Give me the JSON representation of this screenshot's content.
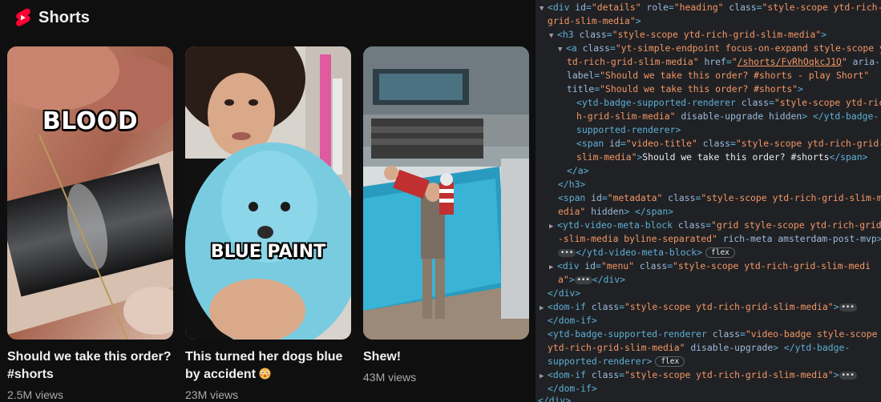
{
  "shelf": {
    "title": "Shorts",
    "cards": [
      {
        "title": "Should we take this order? #shorts",
        "title_line1": "Should we take this order?",
        "title_line2": "#shorts",
        "views": "2.5M views",
        "overlay": "BLOOD"
      },
      {
        "title": "This turned her dogs blue by accident",
        "title_line1": "This turned her dogs blue",
        "title_line2": "by accident",
        "views": "23M views",
        "overlay": "BLUE PAINT"
      },
      {
        "title": "Shew!",
        "title_line1": "Shew!",
        "title_line2": "",
        "views": "43M views",
        "overlay": ""
      }
    ]
  },
  "devtools": {
    "lines": [
      {
        "i": 0,
        "text": "<div id=\"details\" role=\"heading\" class=\"style-scope ytd-rich-"
      },
      {
        "i": 1,
        "text": "grid-slim-media\">"
      },
      {
        "i": 2,
        "text": "<h3 class=\"style-scope ytd-rich-grid-slim-media\">"
      },
      {
        "i": 3,
        "text": "<a class=\"yt-simple-endpoint focus-on-expand style-scope y"
      },
      {
        "i": 4,
        "text": "td-rich-grid-slim-media\" href=\"/shorts/FvRhOqkcJ1Q\" aria-"
      },
      {
        "i": 5,
        "text": "label=\"Should we take this order? #shorts - play Short\""
      },
      {
        "i": 6,
        "text": "title=\"Should we take this order? #shorts\">"
      },
      {
        "i": 7,
        "text": "<ytd-badge-supported-renderer class=\"style-scope ytd-ric"
      },
      {
        "i": 8,
        "text": "h-grid-slim-media\" disable-upgrade hidden> </ytd-badge-"
      },
      {
        "i": 9,
        "text": "supported-renderer>"
      },
      {
        "i": 10,
        "text": "<span id=\"video-title\" class=\"style-scope ytd-rich-grid-"
      },
      {
        "i": 11,
        "text": "slim-media\">Should we take this order? #shorts</span>"
      },
      {
        "i": 12,
        "text": "</a>"
      },
      {
        "i": 13,
        "text": "</h3>"
      },
      {
        "i": 14,
        "text": "<span id=\"metadata\" class=\"style-scope ytd-rich-grid-slim-m"
      },
      {
        "i": 15,
        "text": "edia\" hidden> </span>"
      },
      {
        "i": 16,
        "text": "<ytd-video-meta-block class=\"grid style-scope ytd-rich-grid"
      },
      {
        "i": 17,
        "text": "-slim-media byline-separated\" rich-meta amsterdam-post-mvp>"
      },
      {
        "i": 18,
        "text": "</ytd-video-meta-block>"
      },
      {
        "i": 19,
        "text": "<div id=\"menu\" class=\"style-scope ytd-rich-grid-slim-medi"
      },
      {
        "i": 20,
        "text": "a\">"
      },
      {
        "i": 21,
        "text": "</div>"
      },
      {
        "i": 22,
        "text": "<dom-if class=\"style-scope ytd-rich-grid-slim-media\">"
      },
      {
        "i": 23,
        "text": "</dom-if>"
      },
      {
        "i": 24,
        "text": "<ytd-badge-supported-renderer class=\"video-badge style-scope"
      },
      {
        "i": 25,
        "text": "ytd-rich-grid-slim-media\" disable-upgrade> </ytd-badge-"
      },
      {
        "i": 26,
        "text": "supported-renderer>"
      },
      {
        "i": 27,
        "text": "<dom-if class=\"style-scope ytd-rich-grid-slim-media\">"
      },
      {
        "i": 28,
        "text": "</dom-if>"
      },
      {
        "i": 29,
        "text": "</div>"
      }
    ],
    "badge_flex": "flex"
  },
  "colors": {
    "background": "#0f0f0f",
    "devtools_bg": "#202124",
    "tag": "#5db0d7",
    "attr_name": "#9bbbdc",
    "attr_value": "#f29766",
    "shorts_red": "#ff0033"
  }
}
